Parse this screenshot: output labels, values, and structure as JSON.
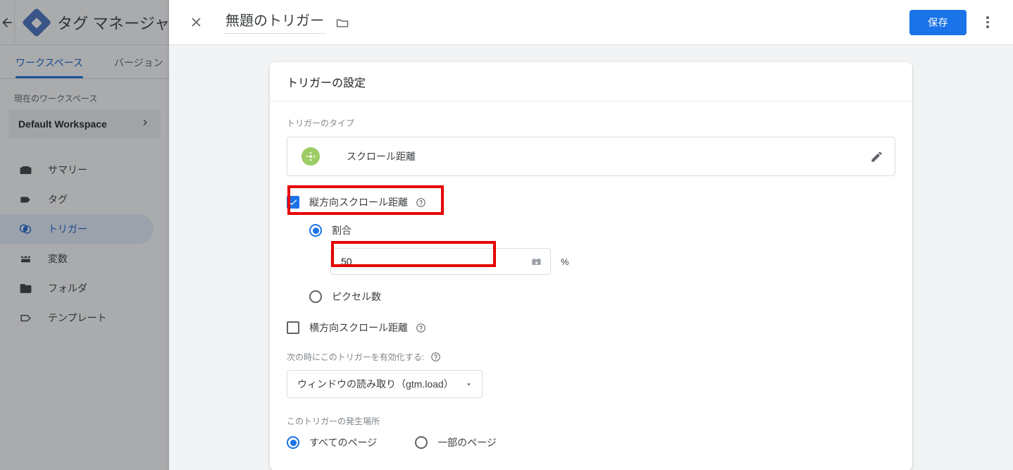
{
  "background_app": {
    "back_icon": "back-arrow-icon",
    "logo_icon": "gtm-logo-icon",
    "title": "タグ マネージャ",
    "tabs": [
      {
        "label": "ワークスペース",
        "active": true
      },
      {
        "label": "バージョン",
        "active": false
      }
    ],
    "workspace_section_label": "現在のワークスペース",
    "workspace_name": "Default Workspace",
    "workspace_chevron": "chevron-right-icon",
    "nav_items": [
      {
        "label": "サマリー",
        "icon": "summary-icon",
        "selected": false
      },
      {
        "label": "タグ",
        "icon": "tag-icon",
        "selected": false
      },
      {
        "label": "トリガー",
        "icon": "trigger-icon",
        "selected": true
      },
      {
        "label": "変数",
        "icon": "variable-icon",
        "selected": false
      },
      {
        "label": "フォルダ",
        "icon": "folder-icon",
        "selected": false
      },
      {
        "label": "テンプレート",
        "icon": "template-icon",
        "selected": false
      }
    ]
  },
  "dialog": {
    "close_icon": "close-icon",
    "title": "無題のトリガー",
    "folder_icon": "folder-icon",
    "save_label": "保存",
    "overflow_icon": "more-vert-icon",
    "card": {
      "header_title": "トリガーの設定",
      "trigger_type_label": "トリガーのタイプ",
      "trigger_type_name": "スクロール距離",
      "trigger_type_icon": "scroll-distance-icon",
      "edit_icon": "pencil-icon",
      "vertical_scroll": {
        "label": "縦方向スクロール距離",
        "checked": true,
        "help_icon": "help-circle-icon",
        "percent_option": {
          "label": "割合",
          "selected": true
        },
        "pixels_option": {
          "label": "ピクセル数",
          "selected": false
        },
        "value": "50",
        "unit": "%",
        "variable_picker_icon": "variable-picker-icon"
      },
      "horizontal_scroll": {
        "label": "横方向スクロール距離",
        "checked": false,
        "help_icon": "help-circle-icon"
      },
      "enable_label": "次の時にこのトリガーを有効化する:",
      "enable_help_icon": "help-circle-icon",
      "enable_value": "ウィンドウの読み取り（gtm.load）",
      "enable_arrow_icon": "chevron-down-icon",
      "fire_label": "このトリガーの発生場所",
      "fire_options": [
        {
          "label": "すべてのページ",
          "selected": true
        },
        {
          "label": "一部のページ",
          "selected": false
        }
      ]
    }
  },
  "annotations": {
    "highlight_color": "#e60000",
    "boxes": [
      {
        "name": "vertical-scroll-checkbox-highlight"
      },
      {
        "name": "percent-value-input-highlight"
      }
    ]
  },
  "colors": {
    "accent_blue": "#1a73e8",
    "trigger_icon_green": "#9ccc65",
    "surface": "#ffffff",
    "page_background": "#f1f3f4"
  }
}
